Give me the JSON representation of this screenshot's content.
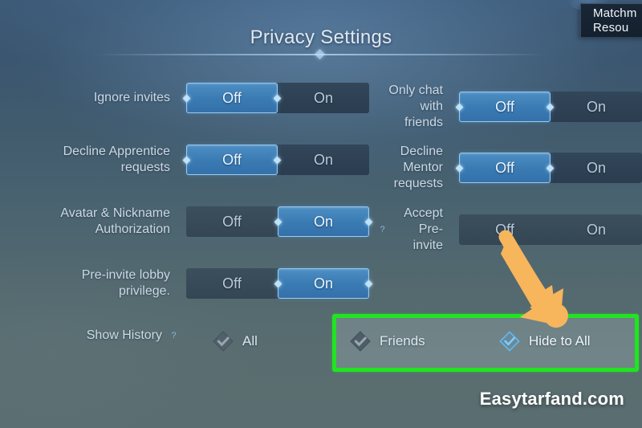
{
  "page": {
    "title": "Privacy Settings",
    "watermark": "Easytarfand.com"
  },
  "corner_panel": {
    "line1": "Matchm",
    "line2": "Resou"
  },
  "toggle_options": {
    "off": "Off",
    "on": "On"
  },
  "help_glyph": "?",
  "settings": {
    "left_column": [
      {
        "label": "Ignore invites",
        "off_label": "Off",
        "on_label": "On",
        "selected": "Off",
        "has_help": false
      },
      {
        "label": "Decline Apprentice\nrequests",
        "off_label": "Off",
        "on_label": "On",
        "selected": "Off",
        "has_help": false
      },
      {
        "label": "Avatar & Nickname\nAuthorization",
        "off_label": "Off",
        "on_label": "On",
        "selected": "On",
        "has_help": false
      },
      {
        "label": "Pre-invite lobby\nprivilege.",
        "off_label": "Off",
        "on_label": "On",
        "selected": "On",
        "has_help": false
      }
    ],
    "right_column": [
      {
        "label": "Only chat with\nfriends",
        "off_label": "Off",
        "selected": "Off",
        "has_help": false
      },
      {
        "label": "Decline Mentor\nrequests",
        "off_label": "Off",
        "selected": "Off",
        "has_help": false
      },
      {
        "label": "Accept Pre-invite",
        "off_label": "Off",
        "selected": "none",
        "has_help": true
      }
    ]
  },
  "show_history": {
    "label": "Show History",
    "help_glyph": "?",
    "options": [
      {
        "label": "All",
        "checked": false
      },
      {
        "label": "Friends",
        "checked": false
      },
      {
        "label": "Hide to All",
        "checked": true
      }
    ]
  },
  "annotations": {
    "highlight_color": "#22e322",
    "arrow_color": "#f5b košer"
  },
  "colors": {
    "accent_blue": "#3b7cb4",
    "highlight_green": "#22e322",
    "arrow_orange": "#f7b55c",
    "panel_dark": "#14202e"
  }
}
